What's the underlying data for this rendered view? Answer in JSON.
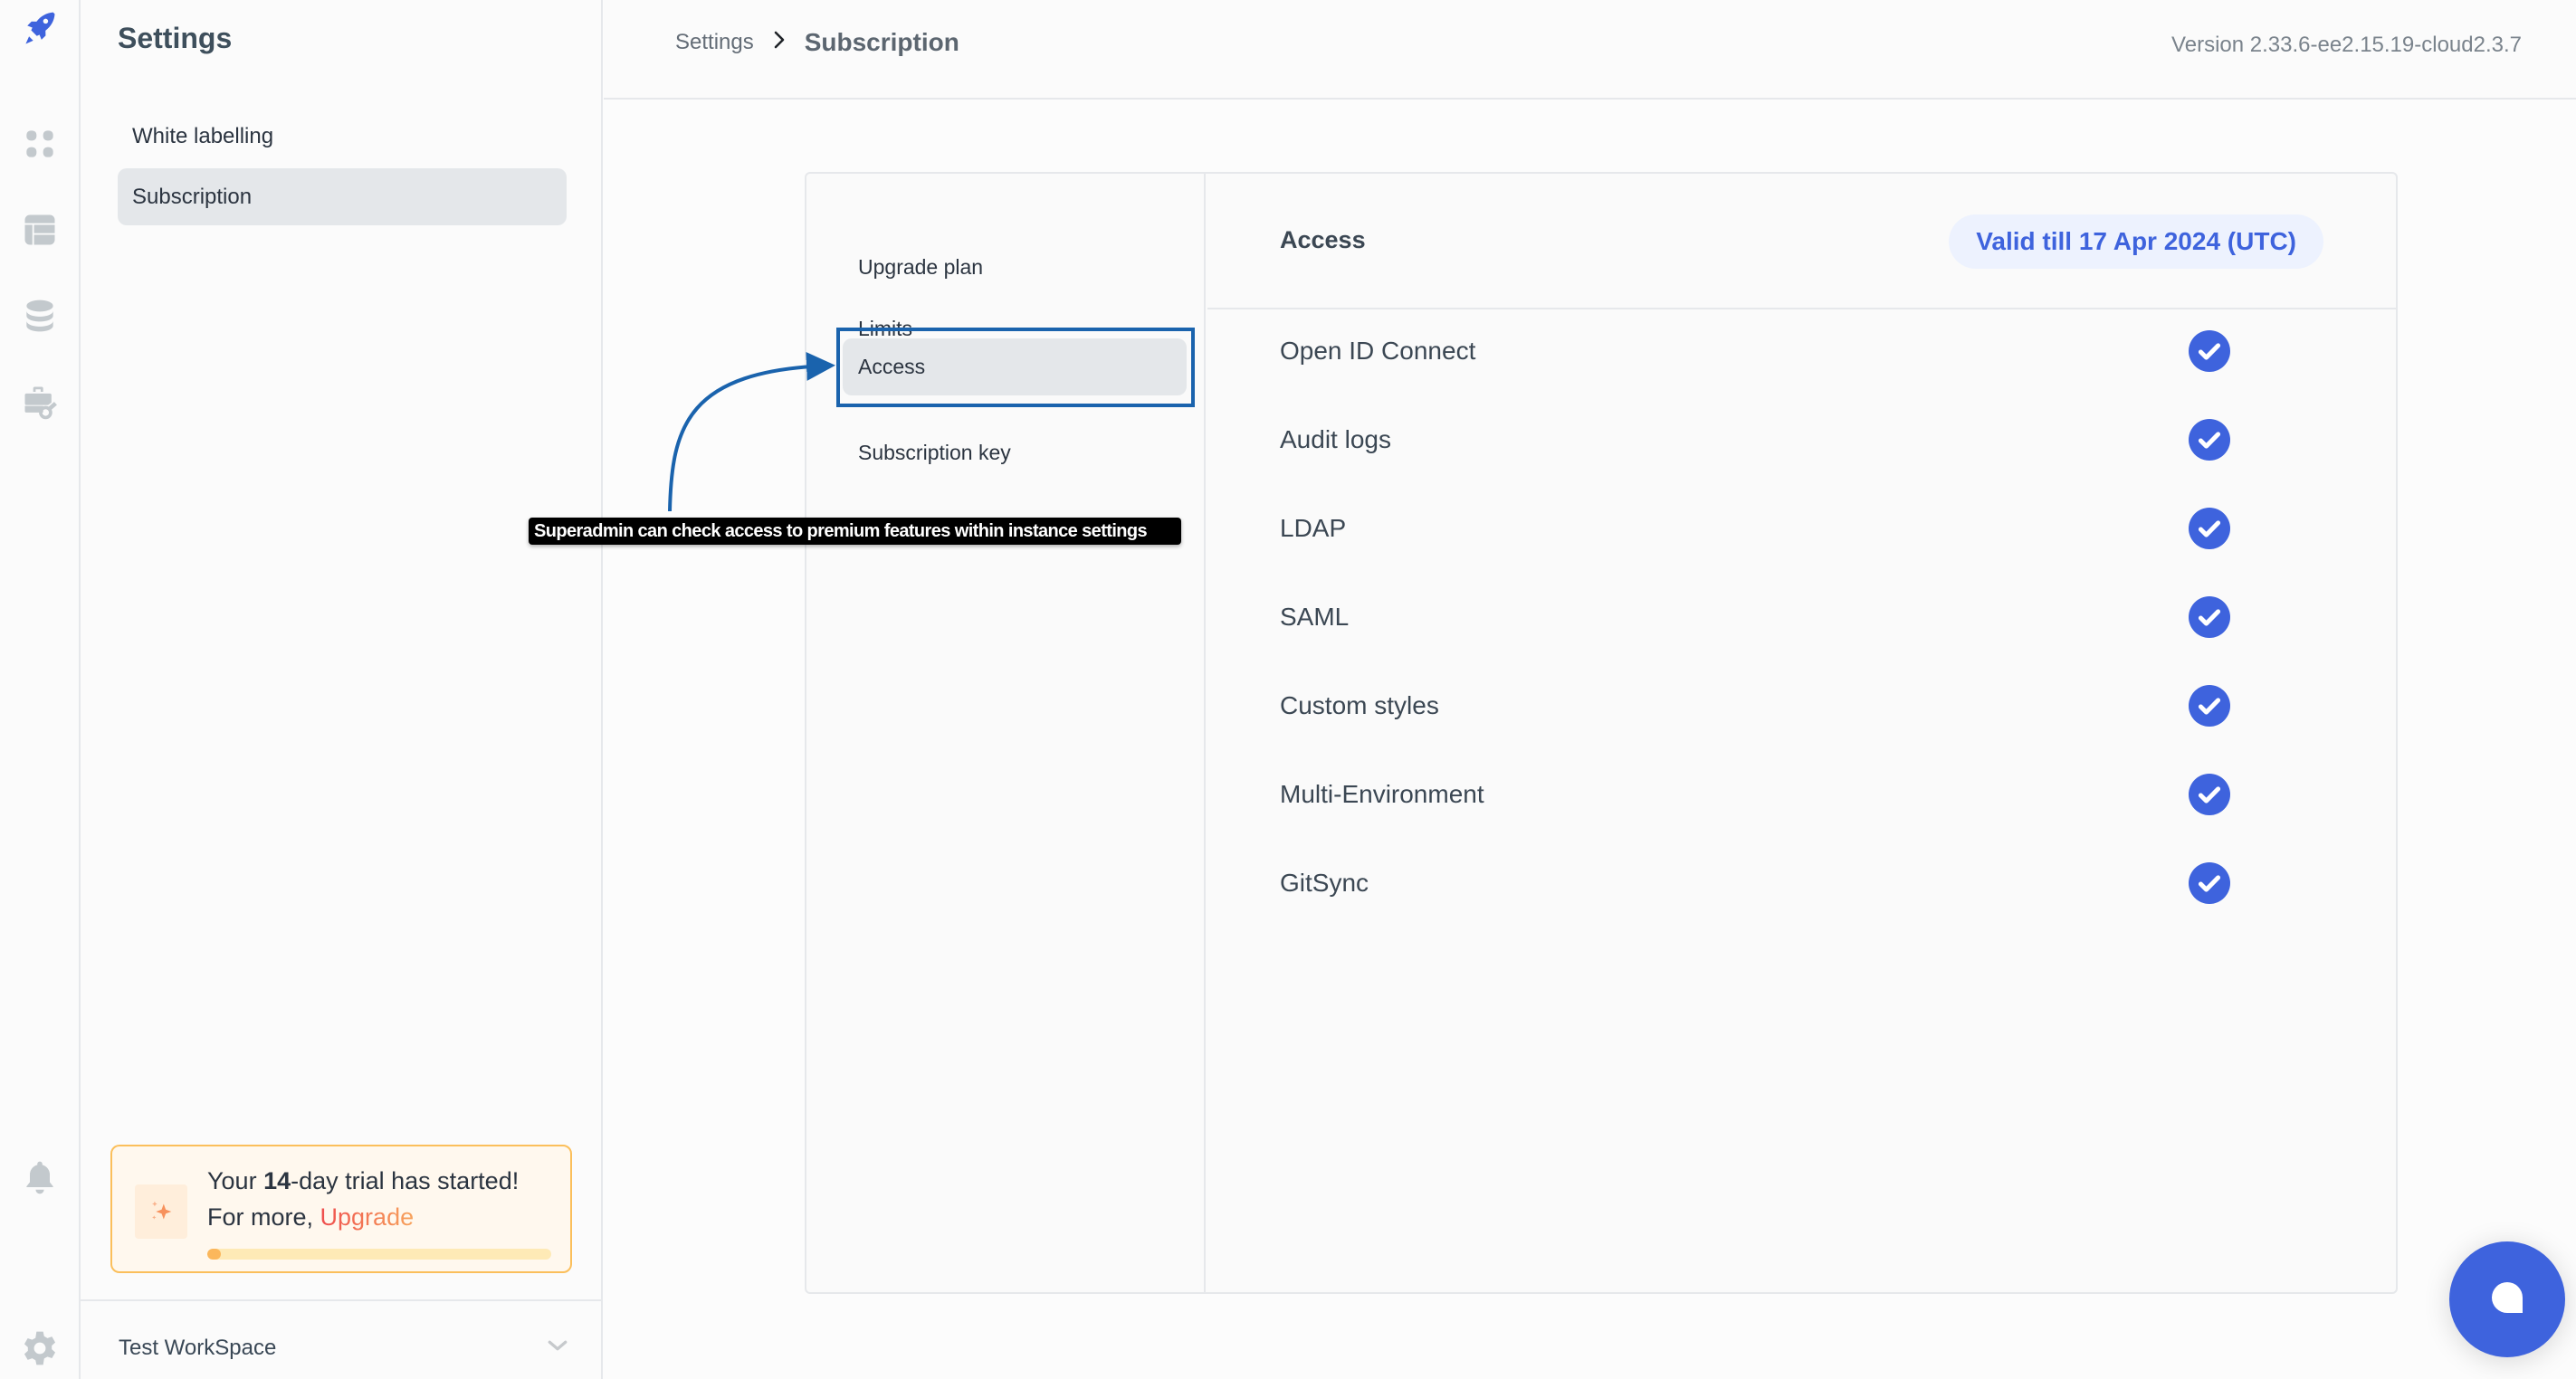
{
  "rail": {
    "logo": "rocket-icon",
    "top_icons": [
      "apps-grid-icon",
      "table-layout-icon",
      "database-icon",
      "workflow-key-icon"
    ],
    "bottom_icons": [
      "bell-icon",
      "moon-icon",
      "gear-icon"
    ]
  },
  "sidebar": {
    "title": "Settings",
    "items": [
      {
        "label": "White labelling",
        "active": false
      },
      {
        "label": "Subscription",
        "active": true
      }
    ],
    "trial": {
      "prefix": "Your ",
      "days": "14",
      "suffix": "-day trial has started!",
      "line2_prefix": "For more, ",
      "upgrade_label": "Upgrade",
      "progress_fraction": 0.04
    },
    "workspace": {
      "name": "Test WorkSpace"
    }
  },
  "header": {
    "breadcrumb": {
      "root": "Settings",
      "current": "Subscription"
    },
    "version": "Version 2.33.6-ee2.15.19-cloud2.3.7"
  },
  "subnav": {
    "items": [
      {
        "label": "Upgrade plan",
        "active": false
      },
      {
        "label": "Limits",
        "active": false
      },
      {
        "label": "Access",
        "active": true
      },
      {
        "label": "Subscription key",
        "active": false
      }
    ]
  },
  "access": {
    "title": "Access",
    "validity": "Valid till 17 Apr 2024 (UTC)",
    "features": [
      {
        "name": "Open ID Connect",
        "enabled": true
      },
      {
        "name": "Audit logs",
        "enabled": true
      },
      {
        "name": "LDAP",
        "enabled": true
      },
      {
        "name": "SAML",
        "enabled": true
      },
      {
        "name": "Custom styles",
        "enabled": true
      },
      {
        "name": "Multi-Environment",
        "enabled": true
      },
      {
        "name": "GitSync",
        "enabled": true
      }
    ]
  },
  "annotation": {
    "text": "Superadmin can check access to premium features within instance settings"
  },
  "colors": {
    "accent": "#3e63dd",
    "annotation": "#1a63ad",
    "trial_border": "#fbbf5b"
  }
}
